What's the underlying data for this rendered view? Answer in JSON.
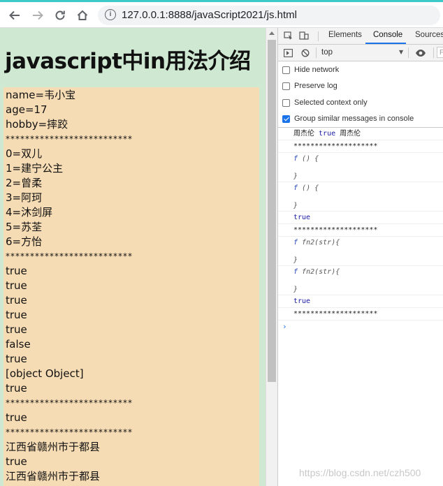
{
  "browser": {
    "url": "127.0.0.1:8888/javaScript2021/js.html",
    "icons": [
      "back-arrow-icon",
      "forward-arrow-icon",
      "reload-icon",
      "home-icon",
      "info-icon"
    ]
  },
  "page": {
    "title": "javascript中in用法介绍",
    "lines": [
      "name=韦小宝",
      "age=17",
      "hobby=摔跤",
      "**************************",
      "0=双儿",
      "1=建宁公主",
      "2=曾柔",
      "3=阿珂",
      "4=沐剑屏",
      "5=苏荃",
      "6=方怡",
      "**************************",
      "true",
      "true",
      "true",
      "true",
      "true",
      "false",
      "true",
      "[object Object]",
      "true",
      "**************************",
      "true",
      "**************************",
      "江西省赣州市于都县",
      "true",
      "江西省赣州市于都县"
    ]
  },
  "devtools": {
    "tabs": [
      "Elements",
      "Console",
      "Sources"
    ],
    "active_tab": "Console",
    "context": "top",
    "filter_initial": "F",
    "options": [
      {
        "label": "Hide network",
        "checked": false
      },
      {
        "label": "Preserve log",
        "checked": false
      },
      {
        "label": "Selected context only",
        "checked": false
      },
      {
        "label": "Group similar messages in console",
        "checked": true
      }
    ],
    "console": {
      "first": {
        "a": "周杰伦",
        "b": "true",
        "c": "周杰伦"
      },
      "stars": "********************",
      "fn_anon": "f () {",
      "fn_named": "f fn2(str){",
      "close": "}",
      "true": "true"
    }
  },
  "watermark": "https://blog.csdn.net/czh500",
  "colors": {
    "page_bg": "#cfe8d2",
    "output_bg": "#f6dcb4",
    "accent": "#1a73e8"
  }
}
